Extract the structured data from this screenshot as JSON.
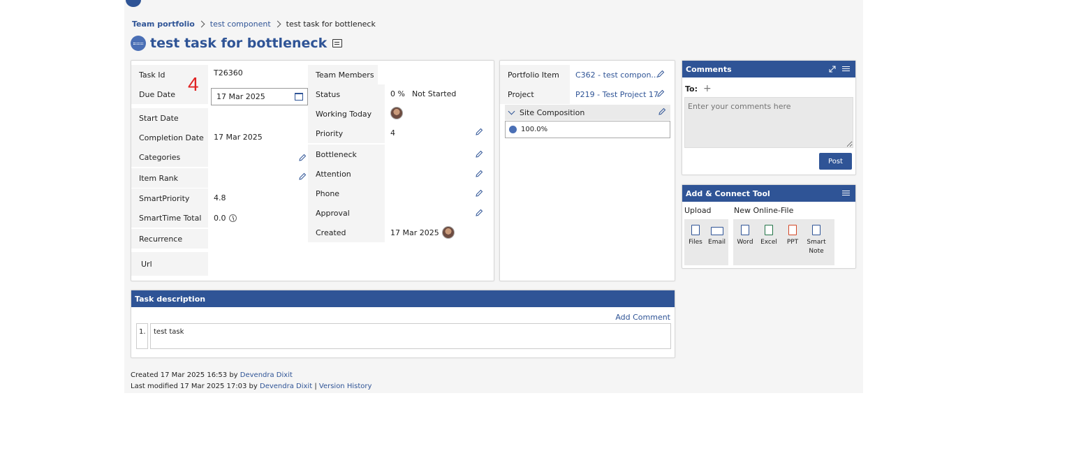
{
  "breadcrumb": {
    "root": "Team portfolio",
    "middle": "test component",
    "current": "test task for bottleneck"
  },
  "title": "test task for bottleneck",
  "left_fields": [
    {
      "label": "Task Id",
      "value": "T26360"
    },
    {
      "label": "Due Date",
      "value": "17 Mar 2025"
    },
    {
      "label": "Start Date",
      "value": ""
    },
    {
      "label": "Completion Date",
      "value": "17 Mar 2025"
    },
    {
      "label": "Categories",
      "value": ""
    },
    {
      "label": "Item Rank",
      "value": ""
    },
    {
      "label": "SmartPriority",
      "value": "4.8"
    },
    {
      "label": "SmartTime Total",
      "value": "0.0"
    },
    {
      "label": "Recurrence",
      "value": ""
    },
    {
      "label": "Url",
      "value": ""
    }
  ],
  "overlay_number": "4",
  "right_fields": [
    {
      "label": "Team Members",
      "value": ""
    },
    {
      "label": "Status",
      "value": "0 %",
      "value2": "Not Started"
    },
    {
      "label": "Working Today",
      "value": ""
    },
    {
      "label": "Priority",
      "value": "4"
    },
    {
      "label": "Bottleneck",
      "value": ""
    },
    {
      "label": "Attention",
      "value": ""
    },
    {
      "label": "Phone",
      "value": ""
    },
    {
      "label": "Approval",
      "value": ""
    },
    {
      "label": "Created",
      "value": "17 Mar 2025"
    }
  ],
  "mid_fields": [
    {
      "label": "Portfolio Item",
      "value": "C362 - test compon..."
    },
    {
      "label": "Project",
      "value": "P219 - Test Project 17"
    }
  ],
  "site_composition": {
    "label": "Site Composition",
    "value": "100.0%"
  },
  "comments": {
    "title": "Comments",
    "to_label": "To:",
    "placeholder": "Enter your comments here",
    "post_label": "Post"
  },
  "add_connect": {
    "title": "Add & Connect Tool",
    "upload_label": "Upload",
    "new_online_label": "New Online-File",
    "upload_tools": [
      "Files",
      "Email"
    ],
    "online_tools": [
      "Word",
      "Excel",
      "PPT",
      "Smart Note"
    ]
  },
  "task_description": {
    "title": "Task description",
    "add_comment": "Add Comment",
    "number": "1.",
    "text": "test task"
  },
  "footer": {
    "created_prefix": "Created 17 Mar 2025 16:53 by",
    "created_by": "Devendra Dixit",
    "modified_prefix": "Last modified 17 Mar 2025 17:03 by",
    "modified_by": "Devendra Dixit",
    "separator": "|",
    "version_history": "Version History"
  },
  "colors": {
    "accent": "#2f5496",
    "overlay_red": "#e02424"
  }
}
